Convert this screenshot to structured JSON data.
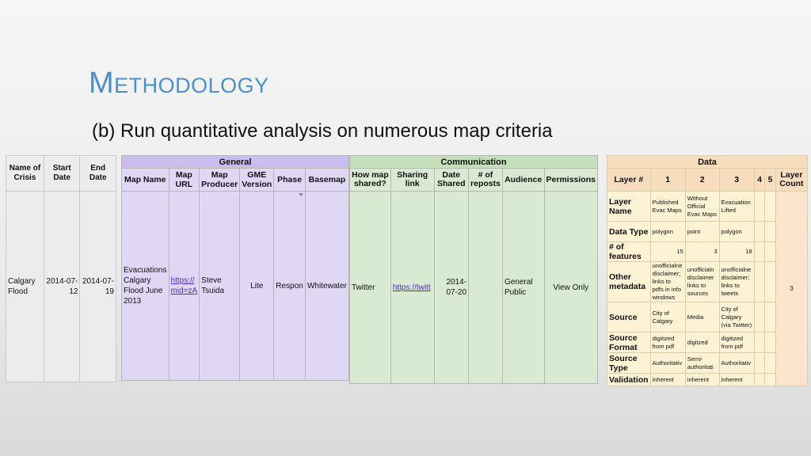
{
  "slide": {
    "title": "Methodology",
    "subtitle": "(b) Run quantitative analysis on numerous map criteria"
  },
  "crisis": {
    "headers": [
      "Name of Crisis",
      "Start Date",
      "End Date"
    ],
    "row": [
      "Calgary Flood",
      "2014-07-12",
      "2014-07-19"
    ]
  },
  "general": {
    "group": "General",
    "headers": [
      "Map Name",
      "Map URL",
      "Map Producer",
      "GME Version",
      "Phase",
      "Basemap"
    ],
    "row": [
      "Evacuations Calgary Flood June 2013",
      "https://\nmid=zA",
      "Steve Tsuida",
      "Lite",
      "Respon",
      "Whitewater"
    ]
  },
  "communication": {
    "group": "Communication",
    "headers": [
      "How map shared?",
      "Sharing link",
      "Date Shared",
      "# of reposts",
      "Audience",
      "Permissions"
    ],
    "row": [
      "Twitter",
      "https://twitt",
      "2014-07-20",
      "",
      "General Public",
      "View Only"
    ]
  },
  "data": {
    "group": "Data",
    "headers": [
      "Layer #",
      "1",
      "2",
      "3",
      "4",
      "5",
      "Layer Count"
    ],
    "layer_count": "3",
    "rows": [
      {
        "label": "Layer Name",
        "c1": "Published Evac Maps",
        "c2": "Without Official Evac Maps",
        "c3": "Evacuation Lifted"
      },
      {
        "label": "Data Type",
        "c1": "polygon",
        "c2": "point",
        "c3": "polygon"
      },
      {
        "label": "# of features",
        "c1": "15",
        "c2": "3",
        "c3": "18"
      },
      {
        "label": "Other metadata",
        "c1": "unofficialne disclaimer; links to pdfs in info windows",
        "c2": "unofficialn disclaimer links to sources",
        "c3": "unofficialne disclaimer; links to tweets"
      },
      {
        "label": "Source",
        "c1": "City of Calgary",
        "c2": "Media",
        "c3": "City of Calgary (via Twitter)"
      },
      {
        "label": "Source Format",
        "c1": "digitized from pdf",
        "c2": "digitzed",
        "c3": "digitized from pdf"
      },
      {
        "label": "Source Type",
        "c1": "Authoritativ",
        "c2": "Semi-authoritati",
        "c3": "Authoritativ"
      },
      {
        "label": "Validation",
        "c1": "inherent",
        "c2": "inherent",
        "c3": "inherent"
      }
    ]
  }
}
